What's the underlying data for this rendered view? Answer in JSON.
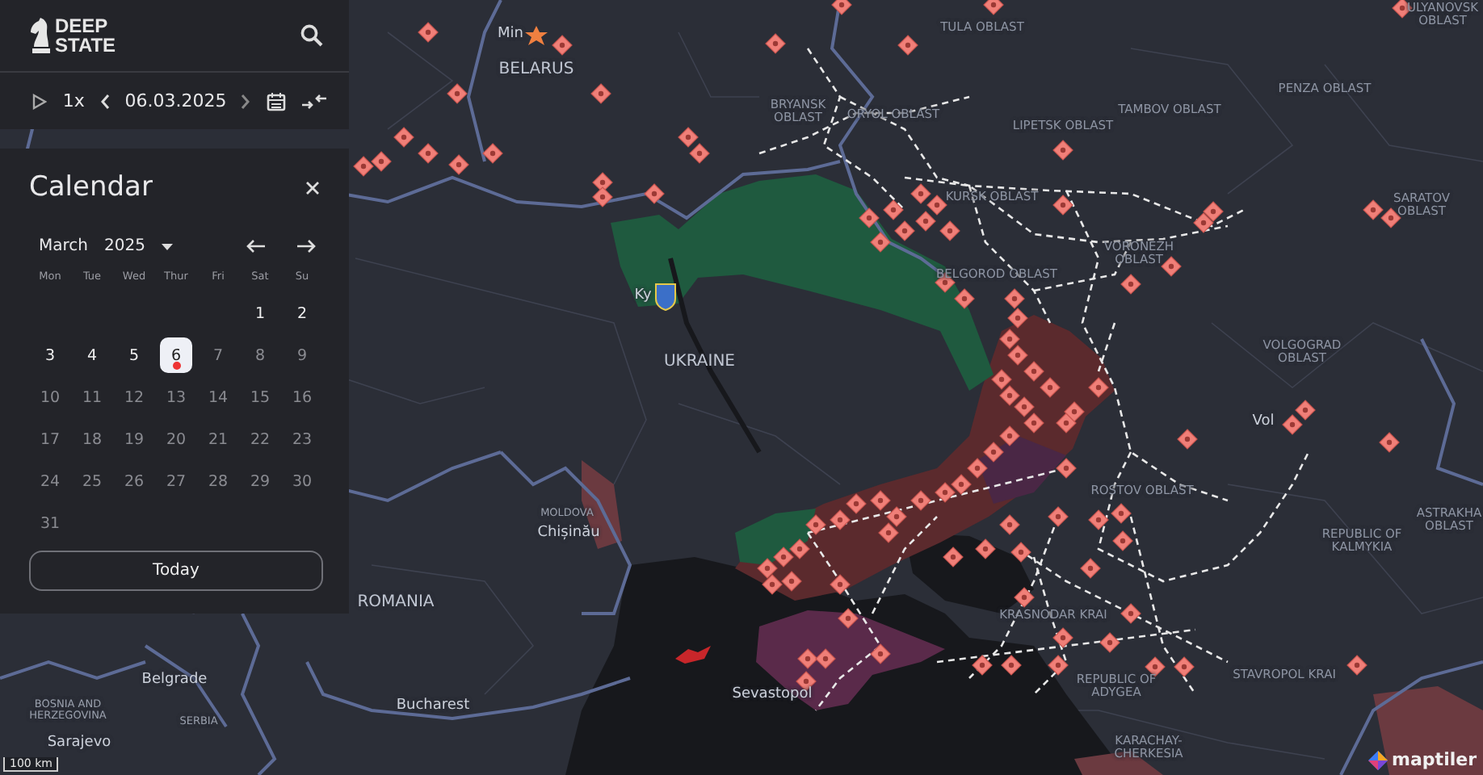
{
  "header": {
    "logo_top": "DEEP",
    "logo_bottom": "STATE"
  },
  "player": {
    "speed": "1x",
    "date": "06.03.2025"
  },
  "calendar": {
    "title": "Calendar",
    "month": "March",
    "year": "2025",
    "weekdays": [
      "Mon",
      "Tue",
      "Wed",
      "Thur",
      "Fri",
      "Sat",
      "Su"
    ],
    "days": [
      {
        "label": "1",
        "selected": false,
        "disabled": false,
        "today": false
      },
      {
        "label": "2",
        "selected": false,
        "disabled": false,
        "today": false
      },
      {
        "label": "3",
        "selected": false,
        "disabled": false,
        "today": false
      },
      {
        "label": "4",
        "selected": false,
        "disabled": false,
        "today": false
      },
      {
        "label": "5",
        "selected": false,
        "disabled": false,
        "today": false
      },
      {
        "label": "6",
        "selected": true,
        "disabled": false,
        "today": true
      },
      {
        "label": "7",
        "selected": false,
        "disabled": true,
        "today": false
      },
      {
        "label": "8",
        "selected": false,
        "disabled": true,
        "today": false
      },
      {
        "label": "9",
        "selected": false,
        "disabled": true,
        "today": false
      },
      {
        "label": "10",
        "selected": false,
        "disabled": true,
        "today": false
      },
      {
        "label": "11",
        "selected": false,
        "disabled": true,
        "today": false
      },
      {
        "label": "12",
        "selected": false,
        "disabled": true,
        "today": false
      },
      {
        "label": "13",
        "selected": false,
        "disabled": true,
        "today": false
      },
      {
        "label": "14",
        "selected": false,
        "disabled": true,
        "today": false
      },
      {
        "label": "15",
        "selected": false,
        "disabled": true,
        "today": false
      },
      {
        "label": "16",
        "selected": false,
        "disabled": true,
        "today": false
      },
      {
        "label": "17",
        "selected": false,
        "disabled": true,
        "today": false
      },
      {
        "label": "18",
        "selected": false,
        "disabled": true,
        "today": false
      },
      {
        "label": "19",
        "selected": false,
        "disabled": true,
        "today": false
      },
      {
        "label": "20",
        "selected": false,
        "disabled": true,
        "today": false
      },
      {
        "label": "21",
        "selected": false,
        "disabled": true,
        "today": false
      },
      {
        "label": "22",
        "selected": false,
        "disabled": true,
        "today": false
      },
      {
        "label": "23",
        "selected": false,
        "disabled": true,
        "today": false
      },
      {
        "label": "24",
        "selected": false,
        "disabled": true,
        "today": false
      },
      {
        "label": "25",
        "selected": false,
        "disabled": true,
        "today": false
      },
      {
        "label": "26",
        "selected": false,
        "disabled": true,
        "today": false
      },
      {
        "label": "27",
        "selected": false,
        "disabled": true,
        "today": false
      },
      {
        "label": "28",
        "selected": false,
        "disabled": true,
        "today": false
      },
      {
        "label": "29",
        "selected": false,
        "disabled": true,
        "today": false
      },
      {
        "label": "30",
        "selected": false,
        "disabled": true,
        "today": false
      },
      {
        "label": "31",
        "selected": false,
        "disabled": true,
        "today": false
      }
    ],
    "today_button": "Today"
  },
  "map_labels": [
    {
      "text": "Min",
      "kind": "city"
    },
    {
      "text": "BELARUS",
      "kind": "country"
    },
    {
      "text": "TULA OBLAST",
      "kind": "region"
    },
    {
      "text": "ULYANOVSK OBLAST",
      "kind": "region"
    },
    {
      "text": "BRYANSK OBLAST",
      "kind": "region"
    },
    {
      "text": "ORYOL OBLAST",
      "kind": "region"
    },
    {
      "text": "LIPETSK OBLAST",
      "kind": "region"
    },
    {
      "text": "TAMBOV OBLAST",
      "kind": "region"
    },
    {
      "text": "PENZA OBLAST",
      "kind": "region"
    },
    {
      "text": "KURSK OBLAST",
      "kind": "region"
    },
    {
      "text": "SARATOV OBLAST",
      "kind": "region"
    },
    {
      "text": "BELGOROD OBLAST",
      "kind": "region"
    },
    {
      "text": "VORONEZH OBLAST",
      "kind": "region"
    },
    {
      "text": "Ky",
      "kind": "city"
    },
    {
      "text": "UKRAINE",
      "kind": "country"
    },
    {
      "text": "VOLGOGRAD OBLAST",
      "kind": "region"
    },
    {
      "text": "Vol",
      "kind": "city"
    },
    {
      "text": "ROSTOV OBLAST",
      "kind": "region"
    },
    {
      "text": "MOLDOVA",
      "kind": "small"
    },
    {
      "text": "Chișinău",
      "kind": "city"
    },
    {
      "text": "REPUBLIC OF KALMYKIA",
      "kind": "region"
    },
    {
      "text": "ASTRAKHA OBLAST",
      "kind": "region"
    },
    {
      "text": "ROMANIA",
      "kind": "country"
    },
    {
      "text": "KRASNODAR KRAI",
      "kind": "region"
    },
    {
      "text": "Belgrade",
      "kind": "city"
    },
    {
      "text": "BOSNIA AND HERZEGOVINA",
      "kind": "small"
    },
    {
      "text": "SERBIA",
      "kind": "small"
    },
    {
      "text": "Bucharest",
      "kind": "city"
    },
    {
      "text": "Sevastopol",
      "kind": "city"
    },
    {
      "text": "REPUBLIC OF ADYGEA",
      "kind": "region"
    },
    {
      "text": "STAVROPOL KRAI",
      "kind": "region"
    },
    {
      "text": "Sarajevo",
      "kind": "city"
    },
    {
      "text": "KARACHAY-CHERKESIA",
      "kind": "region"
    }
  ],
  "scale": "100 km",
  "attribution": "maptiler"
}
